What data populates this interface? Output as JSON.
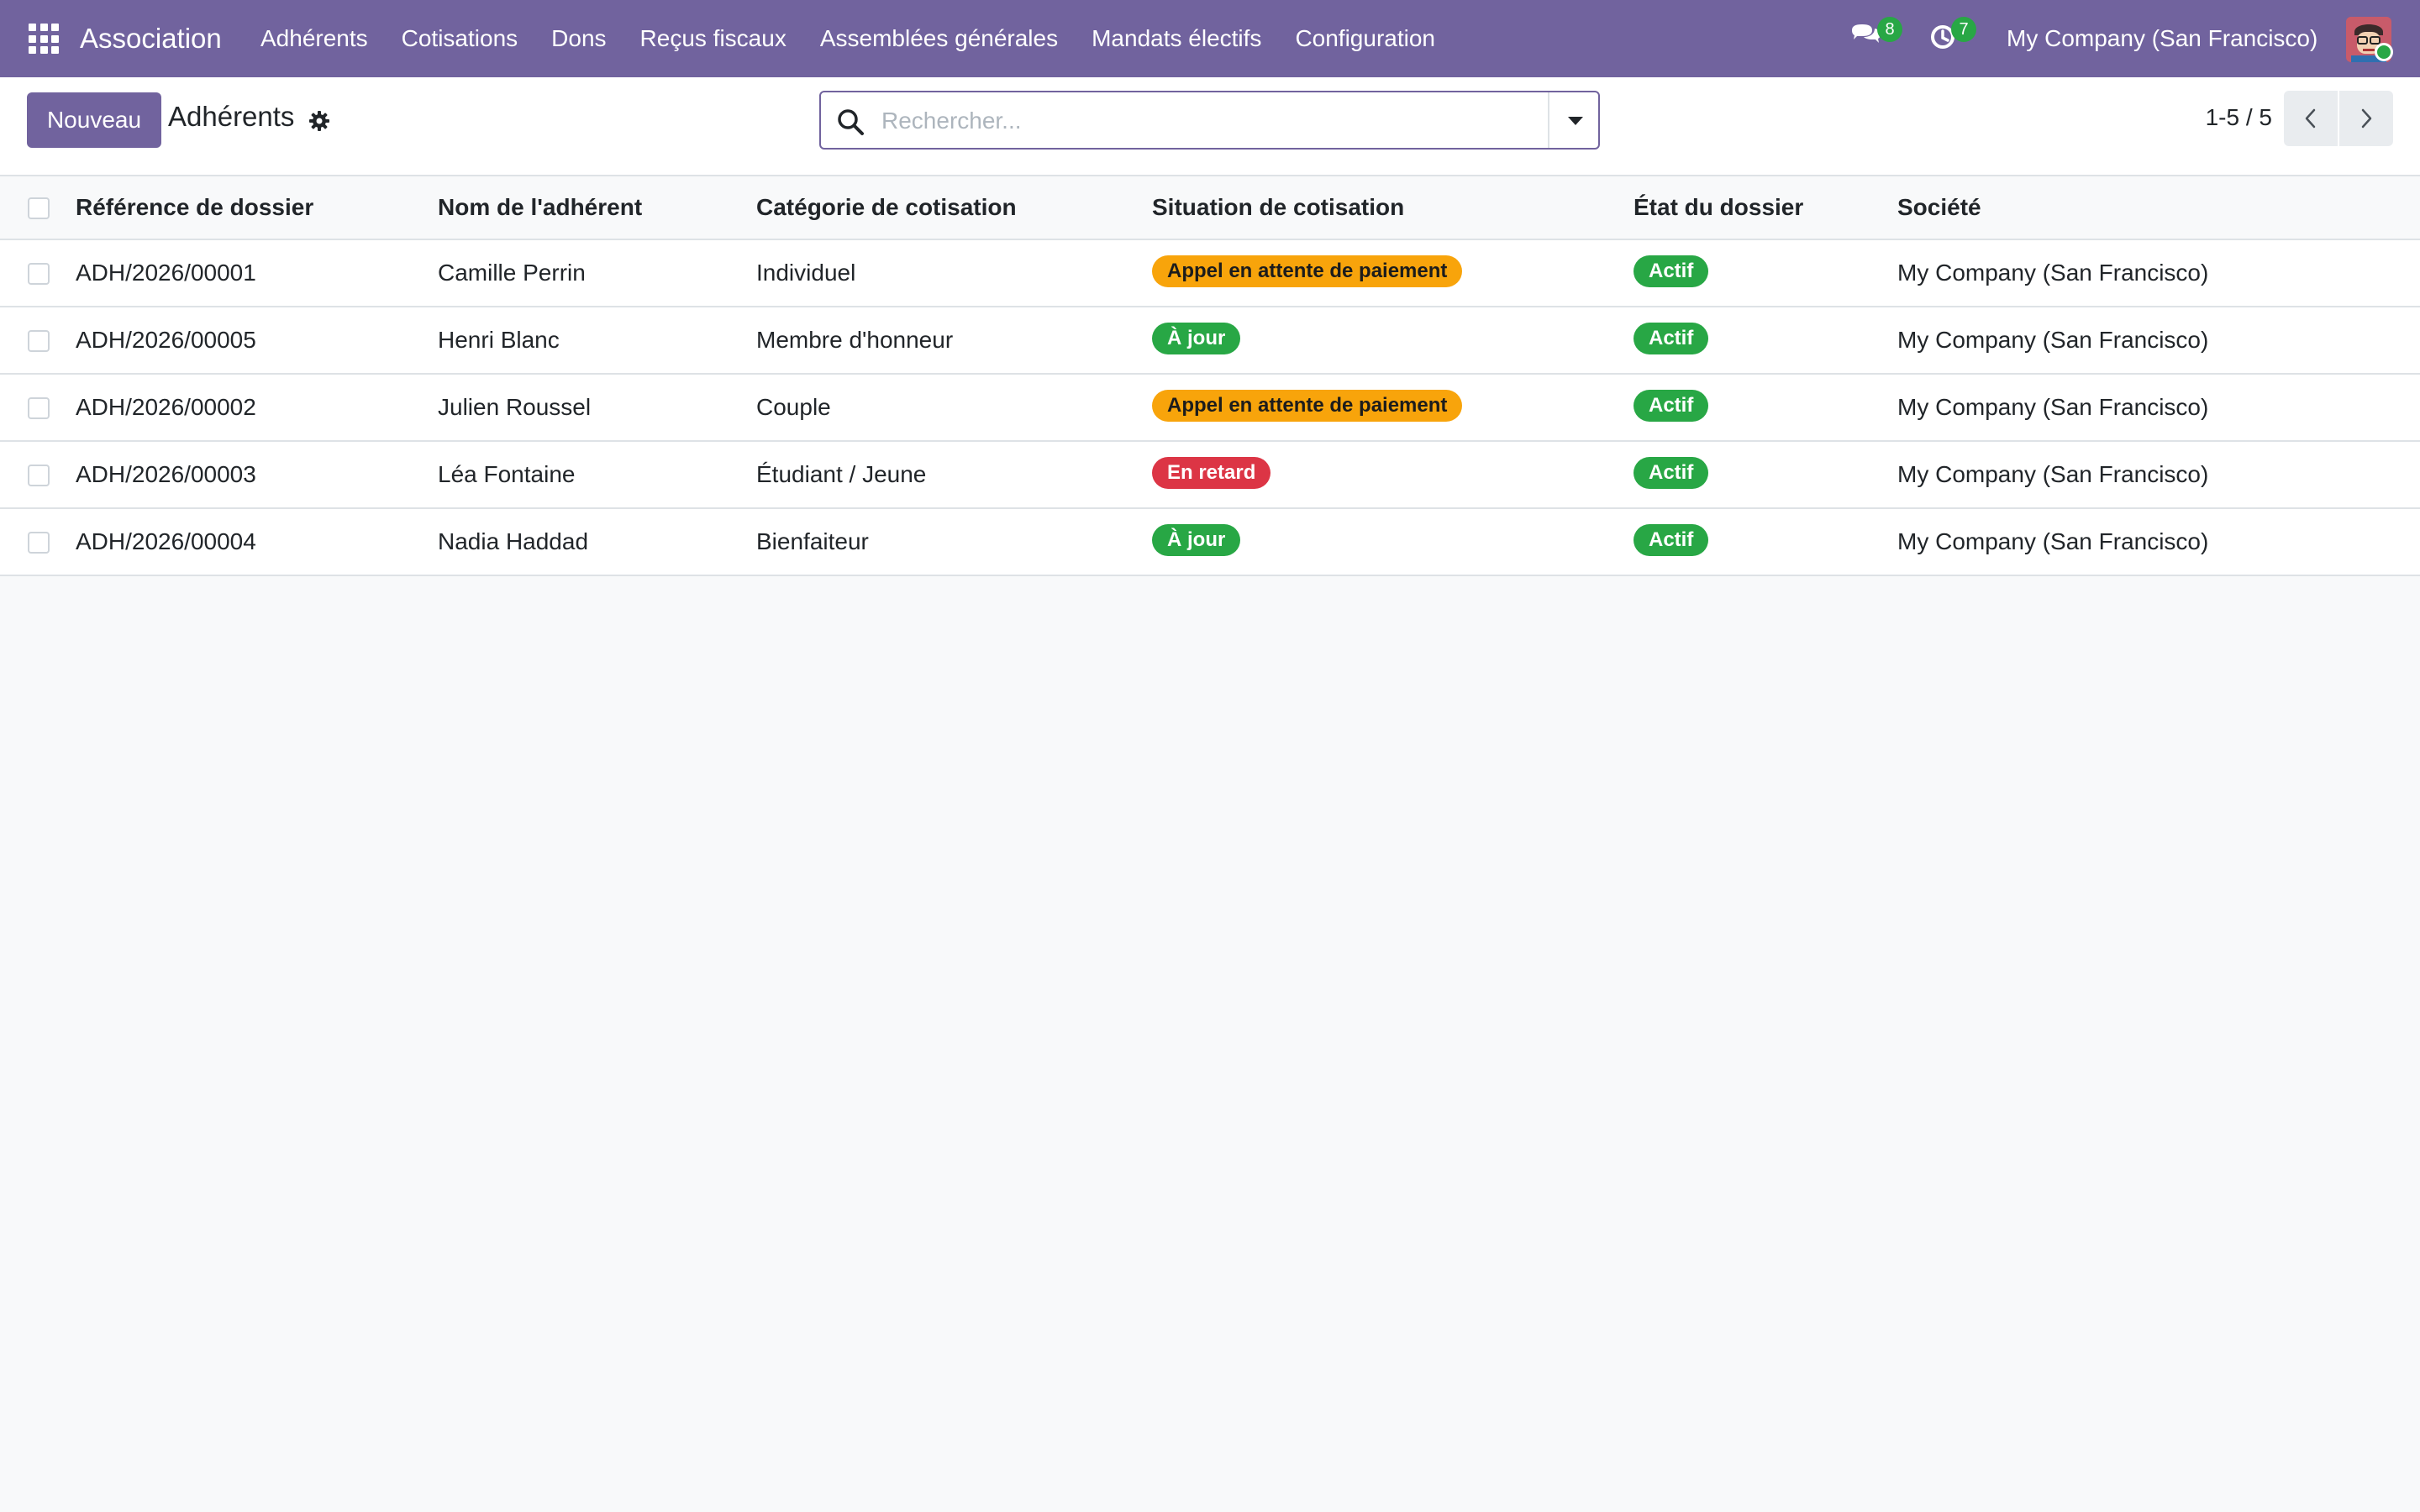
{
  "navbar": {
    "app_name": "Association",
    "menu": [
      {
        "label": "Adhérents"
      },
      {
        "label": "Cotisations"
      },
      {
        "label": "Dons"
      },
      {
        "label": "Reçus fiscaux"
      },
      {
        "label": "Assemblées générales"
      },
      {
        "label": "Mandats électifs"
      },
      {
        "label": "Configuration"
      }
    ],
    "messages_count": "8",
    "activities_count": "7",
    "company": "My Company (San Francisco)",
    "icons": {
      "apps": "apps-grid-icon",
      "messages": "chat-bubbles-icon",
      "activities": "clock-icon",
      "avatar": "user-avatar"
    },
    "colors": {
      "navbar": "#71639e",
      "badge": "#28a745"
    }
  },
  "control_panel": {
    "new_button": "Nouveau",
    "title": "Adhérents",
    "search_placeholder": "Rechercher...",
    "pager": "1-5 / 5"
  },
  "table": {
    "columns": [
      "Référence de dossier",
      "Nom de l'adhérent",
      "Catégorie de cotisation",
      "Situation de cotisation",
      "État du dossier",
      "Société"
    ],
    "rows": [
      {
        "ref": "ADH/2026/00001",
        "name": "Camille Perrin",
        "category": "Individuel",
        "situation": "Appel en attente de paiement",
        "situation_color": "#f8a40b",
        "state": "Actif",
        "company": "My Company (San Francisco)"
      },
      {
        "ref": "ADH/2026/00005",
        "name": "Henri Blanc",
        "category": "Membre d'honneur",
        "situation": "À jour",
        "situation_color": "#28a745",
        "state": "Actif",
        "company": "My Company (San Francisco)"
      },
      {
        "ref": "ADH/2026/00002",
        "name": "Julien Roussel",
        "category": "Couple",
        "situation": "Appel en attente de paiement",
        "situation_color": "#f8a40b",
        "state": "Actif",
        "company": "My Company (San Francisco)"
      },
      {
        "ref": "ADH/2026/00003",
        "name": "Léa Fontaine",
        "category": "Étudiant / Jeune",
        "situation": "En retard",
        "situation_color": "#dc3545",
        "state": "Actif",
        "company": "My Company (San Francisco)"
      },
      {
        "ref": "ADH/2026/00004",
        "name": "Nadia Haddad",
        "category": "Bienfaiteur",
        "situation": "À jour",
        "situation_color": "#28a745",
        "state": "Actif",
        "company": "My Company (San Francisco)"
      }
    ]
  }
}
